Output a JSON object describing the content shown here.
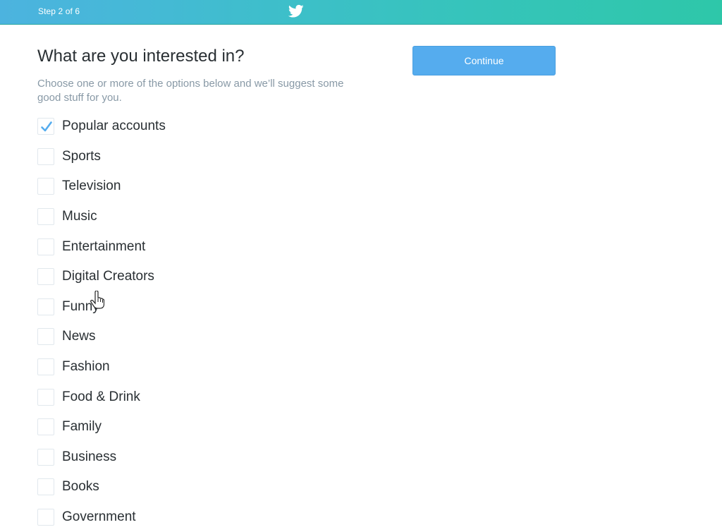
{
  "header": {
    "step_text": "Step 2 of 6",
    "logo_icon": "twitter-bird-icon"
  },
  "main": {
    "title": "What are you interested in?",
    "subtitle": "Choose one or more of the options below and we’ll suggest some good stuff for you.",
    "continue_label": "Continue"
  },
  "interests": [
    {
      "label": "Popular accounts",
      "checked": true
    },
    {
      "label": "Sports",
      "checked": false
    },
    {
      "label": "Television",
      "checked": false
    },
    {
      "label": "Music",
      "checked": false
    },
    {
      "label": "Entertainment",
      "checked": false
    },
    {
      "label": "Digital Creators",
      "checked": false
    },
    {
      "label": "Funny",
      "checked": false
    },
    {
      "label": "News",
      "checked": false
    },
    {
      "label": "Fashion",
      "checked": false
    },
    {
      "label": "Food & Drink",
      "checked": false
    },
    {
      "label": "Family",
      "checked": false
    },
    {
      "label": "Business",
      "checked": false
    },
    {
      "label": "Books",
      "checked": false
    },
    {
      "label": "Government",
      "checked": false
    }
  ],
  "colors": {
    "accent": "#55acee",
    "header_gradient_start": "#4cb3df",
    "header_gradient_end": "#2ec7a9",
    "text_primary": "#292f33",
    "text_secondary": "#8899a6"
  }
}
